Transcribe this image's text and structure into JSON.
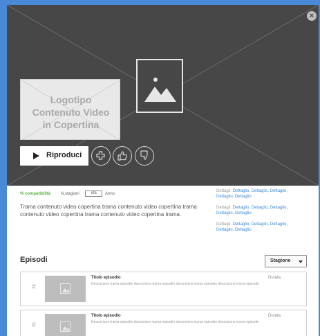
{
  "hero": {
    "logo_text": "Logotipo\nContenuto Video\nin Copertina",
    "play_label": "Riproduci",
    "close_glyph": "×",
    "action_icons": [
      "plus-icon",
      "thumbs-up-icon",
      "thumbs-down-icon"
    ]
  },
  "meta": {
    "match": "% compatibilità",
    "seasons": "N.stagioni",
    "age": "età",
    "year": "Anno"
  },
  "synopsis": "Trama contenuto video copertina trama contenuto video copertina trama contenuto video copertina trama contenuto video copertina trama.",
  "details": [
    {
      "label": "Dettagli:",
      "value": "Dettaglio, Dettaglio, Dettaglio, Dettaglio, Dettaglio"
    },
    {
      "label": "Dettagli:",
      "value": "Dettaglio, Dettaglio, Dettaglio, Dettaglio, Dettaglio"
    },
    {
      "label": "Dettagli:",
      "value": "Dettaglio, Dettaglio, Dettaglio, Dettaglio, Dettaglio"
    }
  ],
  "episodes_section": {
    "title": "Episodi",
    "season_select": "Stagione"
  },
  "episodes": [
    {
      "num": "#",
      "title": "Titolo episodio",
      "description": "Descrizione trama episodio descrizione trama episodio descrizione trama episodio descrizione trama episodio",
      "duration": "Durata"
    },
    {
      "num": "#",
      "title": "Titolo episodio",
      "description": "Descrizione trama episodio descrizione trama episodio descrizione trama episodio descrizione trama episodio",
      "duration": "Durata"
    }
  ],
  "colors": {
    "backdrop": "#4a89d8",
    "hero": "#474747",
    "match_green": "#52b43a",
    "link_blue": "#3b8ad9"
  }
}
